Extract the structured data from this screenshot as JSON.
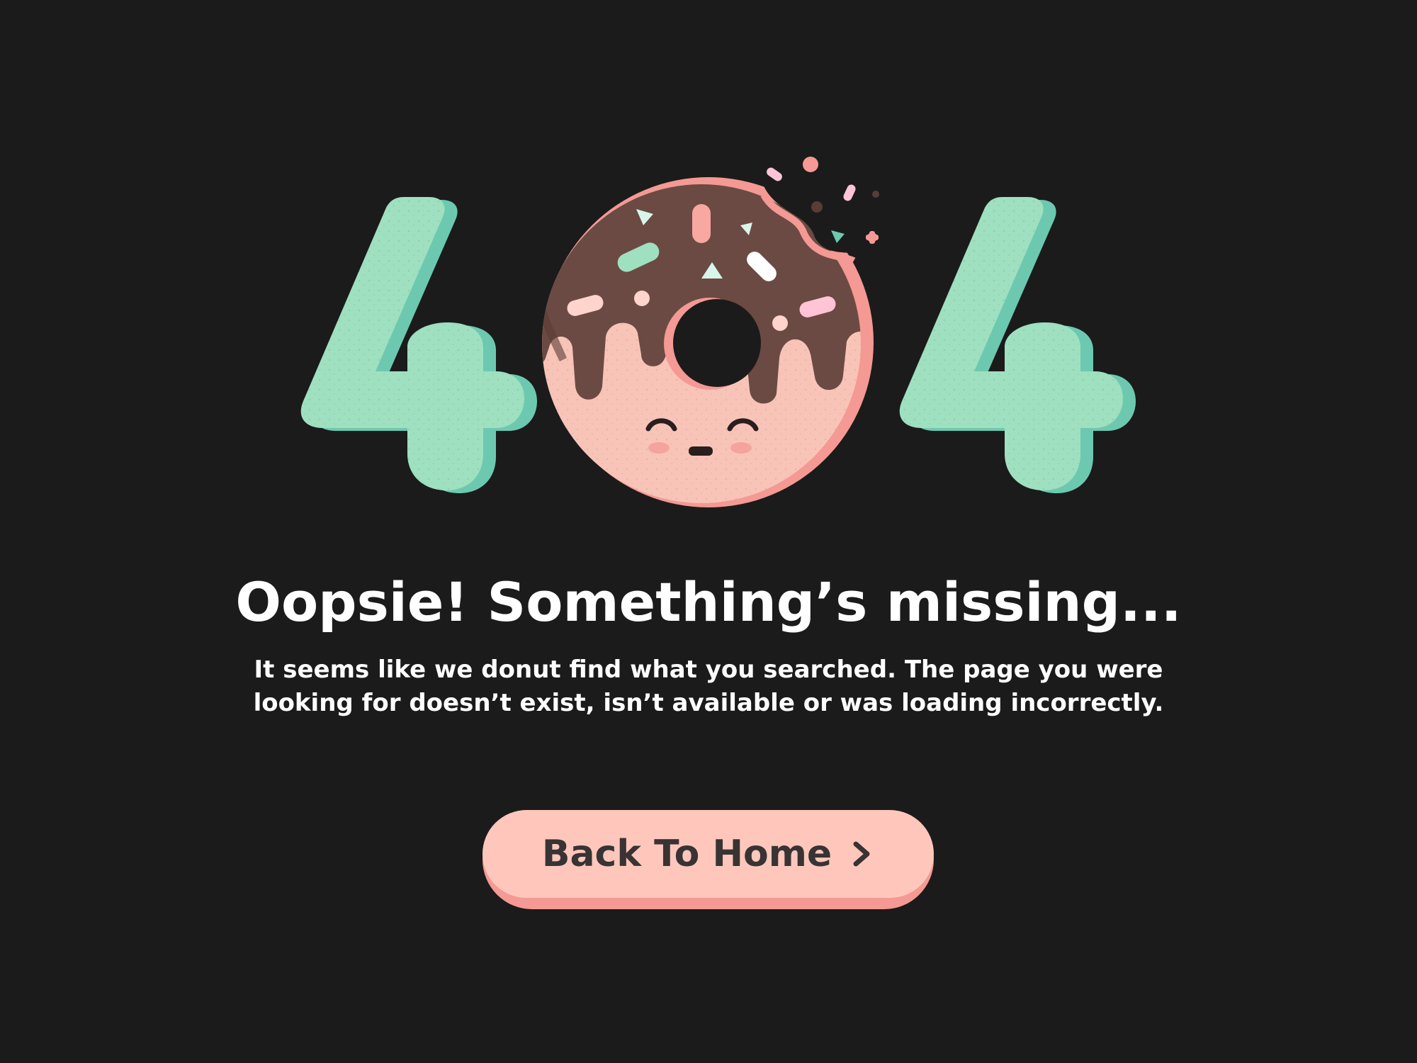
{
  "illustration": {
    "left_digit": "4",
    "right_digit": "4",
    "center_graphic": "bitten donut with sprinkles and sleepy face",
    "colors": {
      "background": "#1b1b1b",
      "digit_face": "#9ee0c0",
      "digit_side": "#6cc9b0",
      "donut_dough": "#f8c4b7",
      "donut_dough_edge": "#f49993",
      "icing": "#6b4a43",
      "icing_dark": "#5a3c36"
    }
  },
  "error": {
    "headline": "Oopsie! Something’s missing...",
    "message_line1": "It seems like we donut find what you searched. The page you were",
    "message_line2": "looking for doesn’t exist, isn’t available or was loading incorrectly."
  },
  "actions": {
    "home_button_label": "Back To Home",
    "home_button_icon": "chevron-right-icon",
    "button_face_color": "#ffc7bb",
    "button_shadow_color": "#f49993"
  }
}
